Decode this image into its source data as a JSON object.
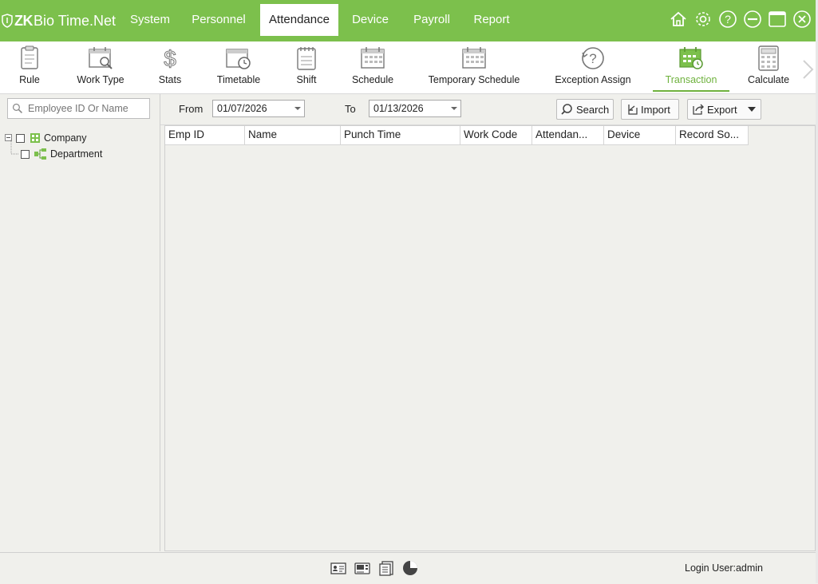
{
  "app": {
    "logo_zk": "ZK",
    "logo_rest": "Bio Time.Net"
  },
  "menu": [
    {
      "label": "System"
    },
    {
      "label": "Personnel"
    },
    {
      "label": "Attendance"
    },
    {
      "label": "Device"
    },
    {
      "label": "Payroll"
    },
    {
      "label": "Report"
    }
  ],
  "active_menu": "Attendance",
  "toolbar": [
    {
      "label": "Rule",
      "icon": "clipboard-icon"
    },
    {
      "label": "Work Type",
      "icon": "calendar-search-icon"
    },
    {
      "label": "Stats",
      "icon": "dollar-icon"
    },
    {
      "label": "Timetable",
      "icon": "calendar-clock-icon"
    },
    {
      "label": "Shift",
      "icon": "notepad-icon"
    },
    {
      "label": "Schedule",
      "icon": "calendar-icon"
    },
    {
      "label": "Temporary Schedule",
      "icon": "calendar-icon"
    },
    {
      "label": "Exception Assign",
      "icon": "question-refresh-icon"
    },
    {
      "label": "Transaction",
      "icon": "calendar-green-icon"
    },
    {
      "label": "Calculate",
      "icon": "calculator-icon"
    }
  ],
  "active_tool": "Transaction",
  "search": {
    "placeholder": "Employee ID Or Name"
  },
  "tree": {
    "root": "Company",
    "child": "Department"
  },
  "filter": {
    "from_label": "From",
    "from_value": "01/07/2026",
    "to_label": "To",
    "to_value": "01/13/2026",
    "search_btn": "Search",
    "import_btn": "Import",
    "export_btn": "Export"
  },
  "grid": {
    "columns": [
      "Emp ID",
      "Name",
      "Punch Time",
      "Work Code",
      "Attendan...",
      "Device",
      "Record So..."
    ]
  },
  "status": {
    "login": "Login User:admin"
  },
  "colors": {
    "brand": "#7cc04c",
    "accent": "#6fb23e"
  }
}
